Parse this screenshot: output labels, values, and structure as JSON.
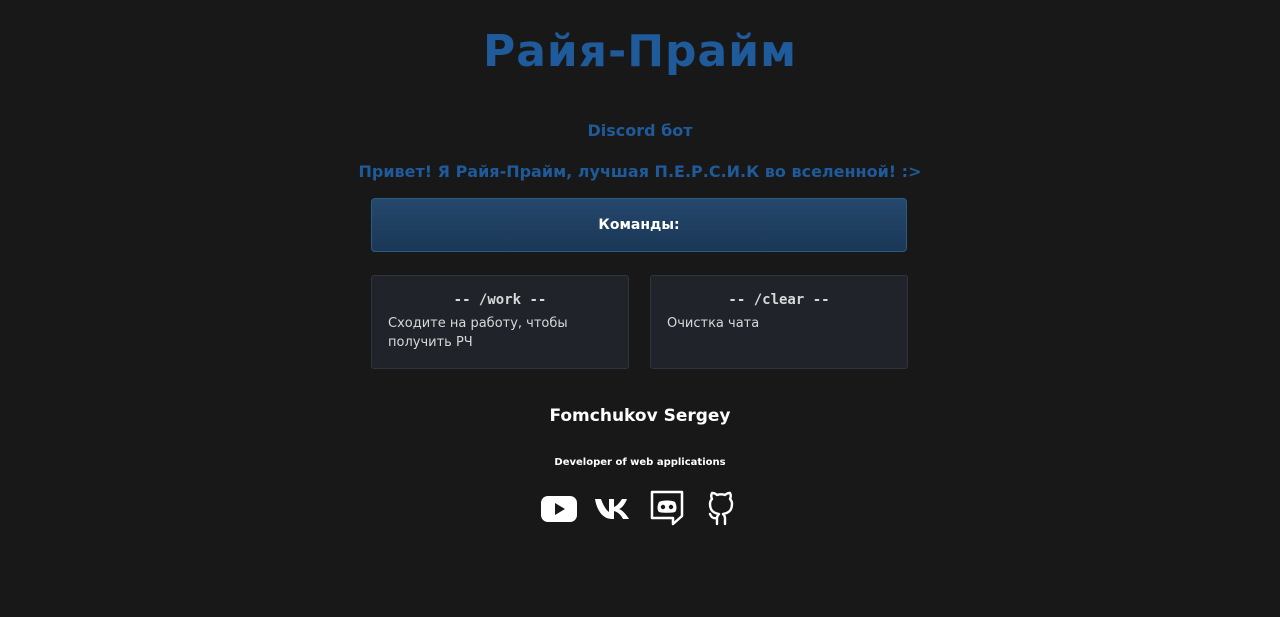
{
  "header": {
    "title": "Райя-Прайм",
    "subtitle": "Discord бот",
    "greeting": "Привет! Я Райя-Прайм, лучшая П.Е.Р.С.И.К во вселенной! :>"
  },
  "commands": {
    "heading": "Команды:",
    "items": [
      {
        "name": "-- /work --",
        "description": "Сходите на работу, чтобы получить РЧ"
      },
      {
        "name": "-- /clear --",
        "description": "Очистка чата"
      }
    ]
  },
  "footer": {
    "name": "Fomchukov Sergey",
    "role": "Developer of web applications",
    "socials": [
      {
        "icon": "youtube-icon"
      },
      {
        "icon": "vk-icon"
      },
      {
        "icon": "discord-icon"
      },
      {
        "icon": "github-icon"
      }
    ]
  },
  "colors": {
    "background": "#181818",
    "accent": "#1f5a9a",
    "card": "#21232b"
  }
}
